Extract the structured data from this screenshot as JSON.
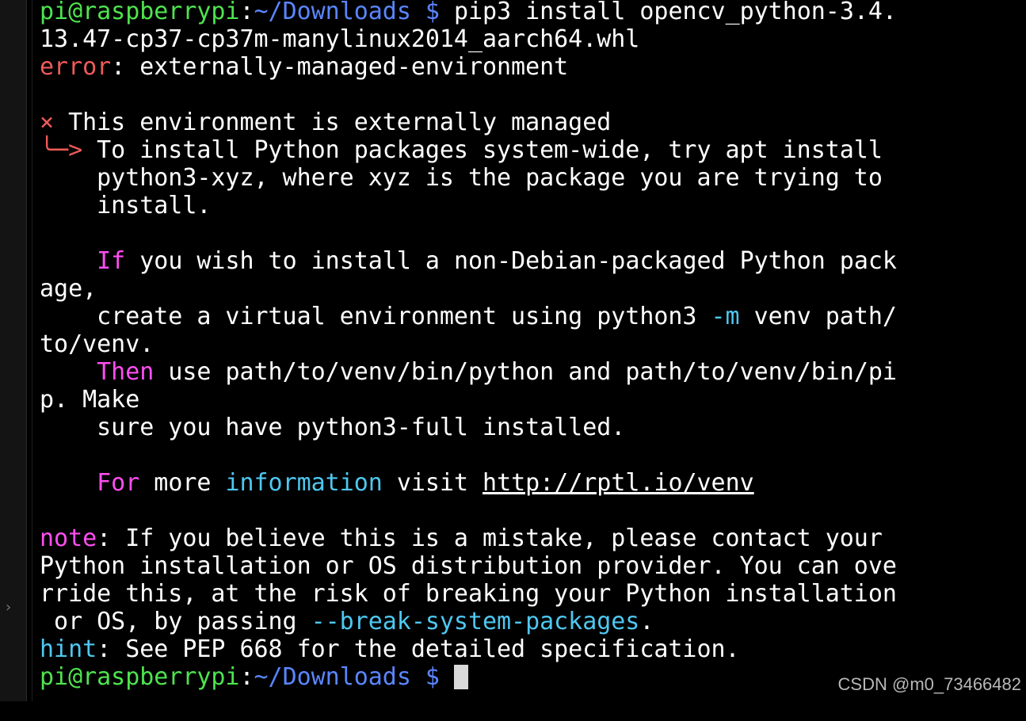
{
  "prompt": {
    "user_host": "pi@raspberrypi",
    "sep": ":",
    "path": "~/Downloads",
    "dollar": " $"
  },
  "lines": {
    "l1_cmd": " pip3 install opencv_python-3.4.",
    "l2": "13.47-cp37-cp37m-manylinux2014_aarch64.whl",
    "l3_error": "error",
    "l3_rest": ": externally-managed-environment",
    "l5_mark": "×",
    "l5_rest": " This environment is externally managed",
    "l6_arrow": "╰─>",
    "l6_rest": " To install Python packages system-wide, try apt install",
    "l7": "    python3-xyz, where xyz is the package you are trying to",
    "l8": "    install.",
    "l10_kw": "If",
    "l10_rest": " you wish to install a non-Debian-packaged Python pack",
    "l11": "age,",
    "l12_a": "    create a virtual environment using python3 ",
    "l12_opt": "-m",
    "l12_b": " venv path/",
    "l13": "to/venv.",
    "l14_kw": "Then",
    "l14_rest": " use path/to/venv/bin/python and path/to/venv/bin/pi",
    "l15": "p. Make",
    "l16": "    sure you have python3-full installed.",
    "l18_kw": "For",
    "l18_a": " more ",
    "l18_info": "information",
    "l18_b": " visit ",
    "l18_url": "http://rptl.io/venv",
    "l20_note": "note",
    "l20_rest": ": If you believe this is a mistake, please contact your",
    "l21": "Python installation or OS distribution provider. You can ove",
    "l22": "rride this, at the risk of breaking your Python installation",
    "l23_a": " or OS, by passing ",
    "l23_flag": "--break-system-packages",
    "l23_b": ".",
    "l24_hint": "hint",
    "l24_rest": ": See PEP 668 for the detailed specification."
  },
  "ui": {
    "chevron_icon": "›",
    "watermark": "CSDN @m0_73466482"
  },
  "colors": {
    "prompt_user": "#4ee44e",
    "prompt_path": "#5a86ff",
    "error": "#f05a5a",
    "keyword": "#ff4ef0",
    "cyan": "#4ec8f0",
    "text": "#ffffff",
    "background": "#000000"
  }
}
